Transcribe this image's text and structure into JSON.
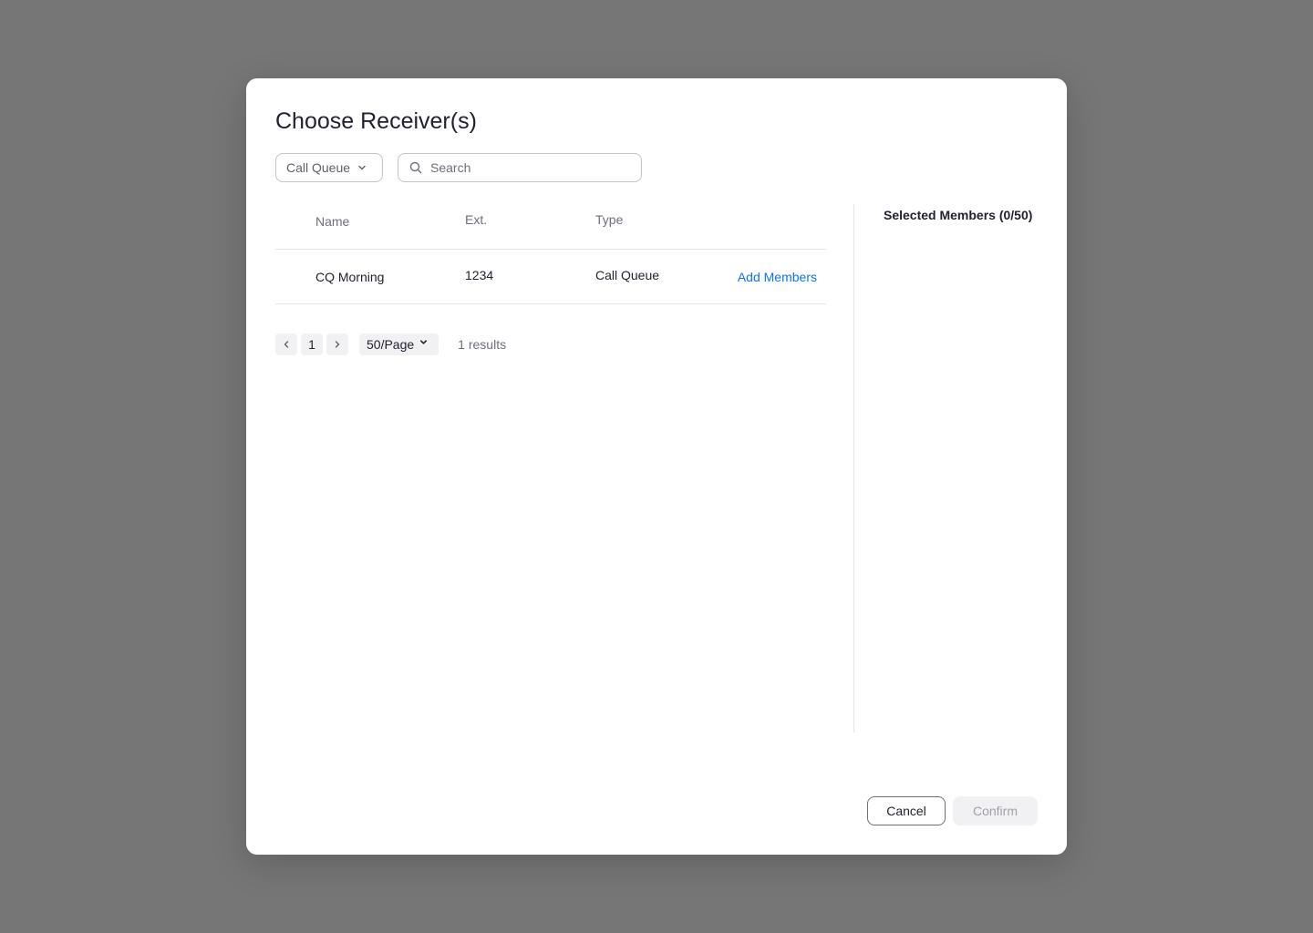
{
  "dialog": {
    "title": "Choose Receiver(s)"
  },
  "filter": {
    "type_label": "Call Queue",
    "search_placeholder": "Search",
    "search_value": ""
  },
  "table": {
    "columns": [
      "Name",
      "Ext.",
      "Type"
    ],
    "rows": [
      {
        "name": "CQ Morning",
        "ext": "1234",
        "type": "Call Queue",
        "action": "Add Members"
      }
    ]
  },
  "pagination": {
    "current_page": "1",
    "per_page": "50/Page",
    "results": "1 results"
  },
  "selected": {
    "title": "Selected Members (0/50)"
  },
  "footer": {
    "cancel_label": "Cancel",
    "confirm_label": "Confirm"
  },
  "colors": {
    "overlay": "#767676",
    "link": "#0e72ed",
    "text": "#222230",
    "muted": "#6e6e7a",
    "disabled_bg": "#f1f1f4"
  },
  "icons": {
    "type_select": "chevron-down-icon",
    "search": "search-icon",
    "prev": "chevron-left-icon",
    "next": "chevron-right-icon",
    "per_page": "chevron-down-icon"
  }
}
